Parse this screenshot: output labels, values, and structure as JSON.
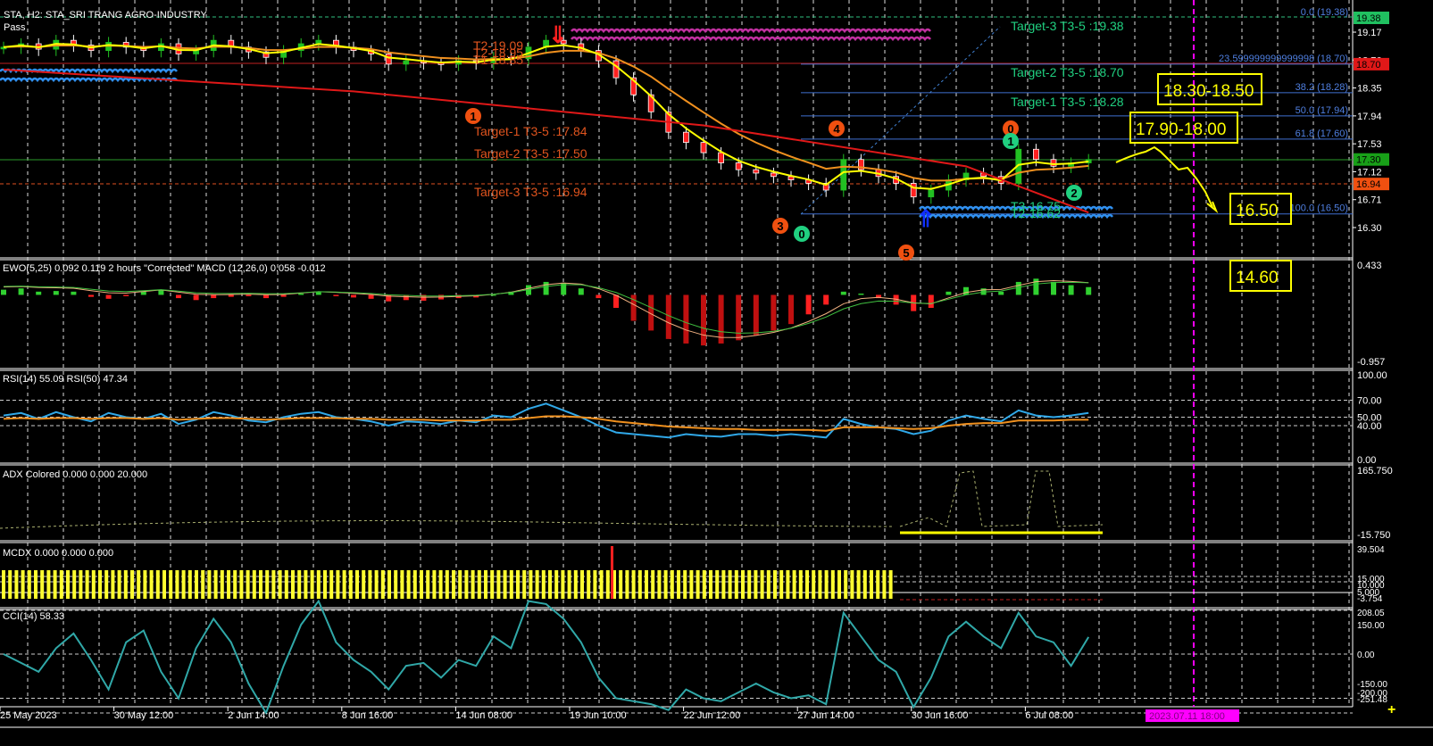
{
  "header": {
    "symbol_title": "STA, H2:  STA_SRI TRANG AGRO-INDUSTRY",
    "status": "Pass"
  },
  "colors": {
    "bg": "#000000",
    "bull": "#22c022",
    "bear": "#ff2020",
    "fast_ma": "#ffff00",
    "slow_ma": "#f0901e",
    "long_ma": "#e01818",
    "fib": "#3f6fd0",
    "target_up": "#20d080",
    "target_down": "#e0541e",
    "annot": "#ffff00",
    "vline": "#ff00ff"
  },
  "chart_data": [
    {
      "type": "candlestick",
      "title": "STA, H2:  STA_SRI TRANG AGRO-INDUSTRY",
      "ylim": [
        16.1,
        19.45
      ],
      "closes": [
        18.95,
        19.0,
        18.92,
        19.05,
        18.98,
        18.9,
        19.02,
        18.95,
        18.9,
        19.0,
        18.85,
        18.9,
        19.05,
        18.95,
        18.88,
        18.8,
        18.9,
        19.0,
        19.05,
        18.95,
        18.9,
        18.85,
        18.7,
        18.75,
        18.72,
        18.7,
        18.75,
        18.72,
        18.8,
        18.78,
        18.95,
        19.05,
        19.0,
        18.9,
        18.75,
        18.5,
        18.25,
        18.0,
        17.7,
        17.55,
        17.4,
        17.25,
        17.15,
        17.1,
        17.05,
        17.0,
        16.95,
        16.85,
        17.3,
        17.15,
        17.05,
        16.95,
        16.75,
        16.85,
        17.0,
        17.1,
        17.05,
        16.95,
        17.45,
        17.3,
        17.2,
        17.25,
        17.3
      ],
      "long_ma": [
        [
          0,
          18.62
        ],
        [
          20,
          18.3
        ],
        [
          40,
          17.8
        ],
        [
          55,
          17.2
        ],
        [
          62,
          16.52
        ]
      ],
      "y_ticks": [
        "19.17",
        "18.76",
        "18.35",
        "17.94",
        "17.53",
        "17.12",
        "16.71",
        "16.30"
      ],
      "price_tags": [
        {
          "value": 19.38,
          "label": "19.38",
          "color": "#20c060"
        },
        {
          "value": 18.7,
          "label": "18.70",
          "color": "#e01818"
        },
        {
          "value": 17.3,
          "label": "17.30",
          "color": "#18a018"
        },
        {
          "value": 16.94,
          "label": "16.94",
          "color": "#f05010"
        }
      ],
      "fib_levels": [
        {
          "value": 19.38,
          "label": "0.0 (19.38)"
        },
        {
          "value": 18.7,
          "label": "23.599999999999998 (18.70)"
        },
        {
          "value": 18.28,
          "label": "38.2 (18.28)"
        },
        {
          "value": 17.94,
          "label": "50.0 (17.94)"
        },
        {
          "value": 17.6,
          "label": "61.8 (17.60)"
        },
        {
          "value": 16.5,
          "label": "100.0 (16.50)"
        }
      ],
      "targets_down": [
        {
          "value": 17.84,
          "label": "Target-1 T3-5 :17.84"
        },
        {
          "value": 17.5,
          "label": "Target-2 T3-5 :17.50"
        },
        {
          "value": 16.94,
          "label": "Target-3 T3-5 :16.94"
        }
      ],
      "targets_up": [
        {
          "value": 19.38,
          "label": "Target-3 T3-5 :19.38"
        },
        {
          "value": 18.7,
          "label": "Target-2 T3-5 :18.70"
        },
        {
          "value": 18.28,
          "label": "Target-1 T3-5 :18.28"
        }
      ],
      "small_labels_top": [
        "T2-19.09",
        "T2-18.95",
        "T1-18.85"
      ],
      "small_labels_bottom": [
        "T3-16.75",
        "T2-16.62"
      ],
      "wave_marks": [
        {
          "text": "1",
          "color": "#f05010"
        },
        {
          "text": "3",
          "color": "#f05010"
        },
        {
          "text": "0",
          "color": "#20d080"
        },
        {
          "text": "4",
          "color": "#f05010"
        },
        {
          "text": "5",
          "color": "#f05010"
        },
        {
          "text": "0",
          "color": "#f05010"
        },
        {
          "text": "1",
          "color": "#20d080"
        },
        {
          "text": "2",
          "color": "#20d080"
        }
      ],
      "annotations": [
        "18.30-18.50",
        "17.90-18.00",
        "16.50",
        "14.60"
      ]
    },
    {
      "type": "bar",
      "title": "EWO(5,25) 0.092 0.119 2 hours \"Corrected\" MACD (12,26,0) 0.058 -0.012",
      "ylim": [
        -0.957,
        0.433
      ],
      "y_ticks": [
        "0.433",
        "-0.957"
      ],
      "values": [
        0.08,
        0.1,
        0.05,
        0.06,
        0.05,
        -0.03,
        -0.06,
        -0.02,
        0.05,
        0.07,
        -0.05,
        -0.08,
        -0.05,
        -0.03,
        -0.02,
        -0.05,
        -0.03,
        0.02,
        0.04,
        -0.02,
        -0.04,
        -0.06,
        -0.1,
        -0.08,
        -0.09,
        -0.07,
        -0.05,
        -0.04,
        0.0,
        0.05,
        0.15,
        0.2,
        0.18,
        0.1,
        -0.05,
        -0.2,
        -0.4,
        -0.55,
        -0.68,
        -0.75,
        -0.78,
        -0.75,
        -0.7,
        -0.62,
        -0.55,
        -0.45,
        -0.3,
        -0.15,
        0.05,
        0.02,
        -0.05,
        -0.15,
        -0.25,
        -0.2,
        0.05,
        0.12,
        0.1,
        0.05,
        0.2,
        0.25,
        0.2,
        0.15,
        0.12
      ]
    },
    {
      "type": "line",
      "title": "RSI(14) 55.09 RSI(50) 47.34",
      "ylim": [
        0,
        100
      ],
      "y_ticks": [
        "100.00",
        "70.00",
        "50.00",
        "40.00",
        "0.00"
      ],
      "series": [
        {
          "name": "RSI(14)",
          "color": "#30a8e8",
          "values": [
            52,
            55,
            48,
            56,
            50,
            45,
            55,
            50,
            48,
            54,
            42,
            47,
            56,
            52,
            46,
            44,
            50,
            54,
            56,
            50,
            48,
            45,
            40,
            45,
            44,
            42,
            46,
            44,
            52,
            50,
            60,
            66,
            58,
            50,
            40,
            32,
            30,
            28,
            26,
            30,
            28,
            27,
            30,
            30,
            28,
            30,
            28,
            26,
            48,
            42,
            38,
            36,
            30,
            34,
            46,
            52,
            48,
            45,
            58,
            52,
            50,
            52,
            55
          ]
        },
        {
          "name": "RSI(50)",
          "color": "#f0901e",
          "values": [
            48,
            49,
            48,
            49,
            49,
            48,
            49,
            49,
            48,
            49,
            47,
            48,
            49,
            49,
            48,
            47,
            48,
            49,
            49,
            49,
            48,
            48,
            47,
            47,
            47,
            46,
            46,
            46,
            47,
            47,
            49,
            51,
            51,
            50,
            48,
            45,
            43,
            41,
            39,
            38,
            37,
            36,
            36,
            35,
            35,
            35,
            35,
            34,
            38,
            38,
            38,
            37,
            36,
            37,
            40,
            42,
            43,
            43,
            46,
            46,
            46,
            47,
            47
          ]
        }
      ]
    },
    {
      "type": "line",
      "title": "ADX Colored 0.000 0.000 20.000",
      "ylim": [
        -15.75,
        165.75
      ],
      "y_ticks": [
        "165.750",
        "-15.750"
      ]
    },
    {
      "type": "bar",
      "title": "MCDX 0.000 0.000 0.000",
      "ylim": [
        -3.754,
        39.504
      ],
      "y_ticks": [
        "39.504",
        "15.000",
        "10.000",
        "5.000",
        "-3.754"
      ]
    },
    {
      "type": "line",
      "title": "CCI(14) 58.33",
      "ylim": [
        -251.48,
        208.05
      ],
      "y_ticks": [
        "208.05",
        "150.00",
        "0.00",
        "-150.00",
        "-200.00",
        "-251.48"
      ],
      "values": [
        0,
        -30,
        -60,
        20,
        70,
        -20,
        -120,
        40,
        80,
        -60,
        -150,
        20,
        120,
        40,
        -100,
        -200,
        -40,
        100,
        180,
        40,
        -20,
        -60,
        -120,
        -40,
        -30,
        -80,
        -20,
        -40,
        60,
        20,
        180,
        170,
        120,
        40,
        -80,
        -150,
        -160,
        -170,
        -190,
        -120,
        -150,
        -160,
        -130,
        -100,
        -130,
        -150,
        -140,
        -170,
        140,
        60,
        -20,
        -60,
        -180,
        -80,
        60,
        110,
        60,
        20,
        140,
        60,
        40,
        -40,
        58
      ]
    }
  ],
  "x_axis": {
    "labels": [
      "25 May 2023",
      "30 May 12:00",
      "2 Jun 14:00",
      "8 Jun 16:00",
      "14 Jun 08:00",
      "19 Jun 10:00",
      "22 Jun 12:00",
      "27 Jun 14:00",
      "30 Jun 16:00",
      "6 Jul 08:00"
    ],
    "cursor_time": "2023.07.11 18:00"
  }
}
